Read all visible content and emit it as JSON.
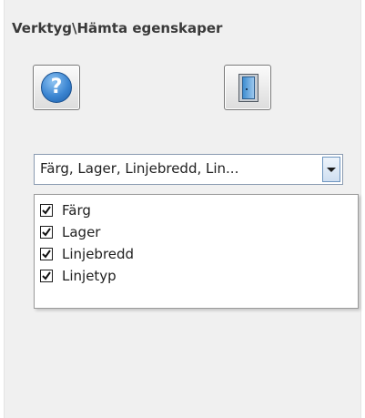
{
  "panel": {
    "title": "Verktyg\\Hämta egenskaper"
  },
  "toolbar": {
    "help_button": {
      "icon": "help-icon",
      "glyph": "?"
    },
    "exit_button": {
      "icon": "door-exit-icon"
    }
  },
  "properties_combo": {
    "value": "Färg, Lager, Linjebredd, Lin..."
  },
  "properties_list": {
    "items": [
      {
        "label": "Färg",
        "checked": true
      },
      {
        "label": "Lager",
        "checked": true
      },
      {
        "label": "Linjebredd",
        "checked": true
      },
      {
        "label": "Linjetyp",
        "checked": true
      }
    ]
  },
  "colors": {
    "panel_bg": "#f0f0f0",
    "accent_blue": "#3c86d2"
  }
}
